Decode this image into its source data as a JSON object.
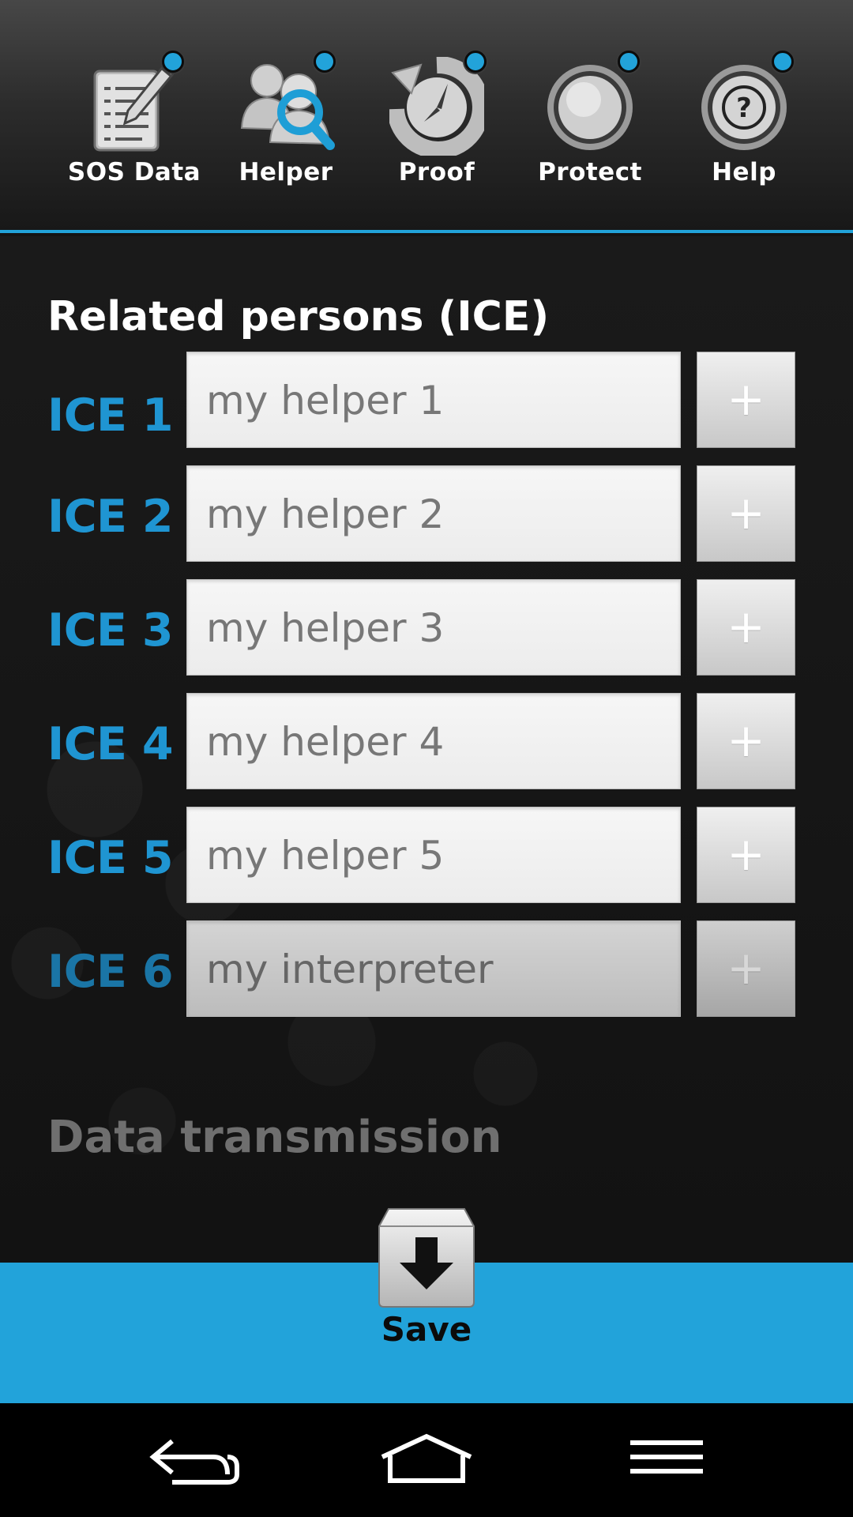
{
  "toolbar": {
    "items": [
      {
        "label": "SOS Data",
        "icon": "clipboard-pencil-icon",
        "has_badge": true
      },
      {
        "label": "Helper",
        "icon": "people-search-icon",
        "has_badge": true
      },
      {
        "label": "Proof",
        "icon": "history-clock-icon",
        "has_badge": true
      },
      {
        "label": "Protect",
        "icon": "round-button-icon",
        "has_badge": true
      },
      {
        "label": "Help",
        "icon": "question-mark-icon",
        "has_badge": true
      }
    ]
  },
  "main": {
    "section_title": "Related persons (ICE)",
    "ice": [
      {
        "label": "ICE 1",
        "value": "my helper 1",
        "add": "+",
        "enabled": true
      },
      {
        "label": "ICE 2",
        "value": "my helper 2",
        "add": "+",
        "enabled": true
      },
      {
        "label": "ICE 3",
        "value": "my helper 3",
        "add": "+",
        "enabled": true
      },
      {
        "label": "ICE 4",
        "value": "my helper 4",
        "add": "+",
        "enabled": true
      },
      {
        "label": "ICE 5",
        "value": "my helper 5",
        "add": "+",
        "enabled": true
      },
      {
        "label": "ICE 6",
        "value": "my interpreter",
        "add": "+",
        "enabled": false
      }
    ],
    "data_transmission_title": "Data transmission"
  },
  "save": {
    "label": "Save",
    "icon": "download-arrow-icon"
  },
  "navbar": {
    "back_icon": "back-arrow-icon",
    "home_icon": "home-icon",
    "menu_icon": "menu-icon"
  },
  "colors": {
    "accent": "#22a3da",
    "ice_label": "#1f95d2"
  }
}
